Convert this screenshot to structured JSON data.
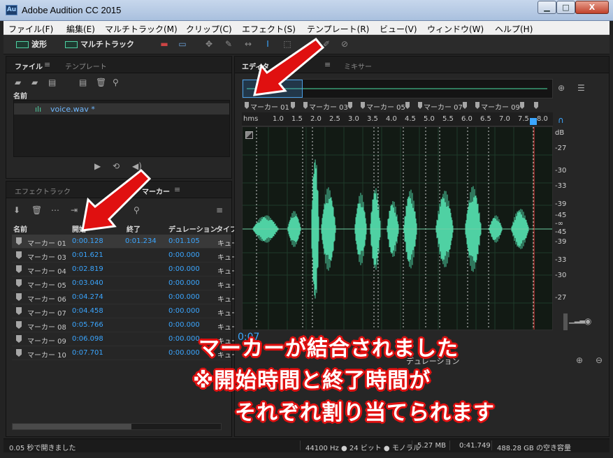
{
  "window": {
    "title": "Adobe Audition CC 2015",
    "app_icon": "Au",
    "min": "▁",
    "max": "□",
    "close": "X"
  },
  "menu": [
    "ファイル(F)",
    "編集(E)",
    "マルチトラック(M)",
    "クリップ(C)",
    "エフェクト(S)",
    "テンプレート(R)",
    "ビュー(V)",
    "ウィンドウ(W)",
    "ヘルプ(H)"
  ],
  "toolbar": {
    "waveform": "波形",
    "multitrack": "マルチトラック"
  },
  "files_panel": {
    "tab_active": "ファイル",
    "tab_other": "テンプレート",
    "col_name": "名前",
    "file": "voice.wav *"
  },
  "bottom_panel": {
    "tab_effects": "エフェクトラック",
    "tab_markers": "マーカー"
  },
  "markers_table": {
    "headers": {
      "name": "名前",
      "start": "開始",
      "end": "終了",
      "duration": "デュレーション",
      "type": "タイプ"
    },
    "rows": [
      {
        "name": "マーカー 01",
        "start": "0:00.128",
        "end": "0:01.234",
        "duration": "0:01.105",
        "type": "キュー"
      },
      {
        "name": "マーカー 03",
        "start": "0:01.621",
        "end": "",
        "duration": "0:00.000",
        "type": "キュー"
      },
      {
        "name": "マーカー 04",
        "start": "0:02.819",
        "end": "",
        "duration": "0:00.000",
        "type": "キュー"
      },
      {
        "name": "マーカー 05",
        "start": "0:03.040",
        "end": "",
        "duration": "0:00.000",
        "type": "キュー"
      },
      {
        "name": "マーカー 06",
        "start": "0:04.274",
        "end": "",
        "duration": "0:00.000",
        "type": "キュー"
      },
      {
        "name": "マーカー 07",
        "start": "0:04.458",
        "end": "",
        "duration": "0:00.000",
        "type": "キュー"
      },
      {
        "name": "マーカー 08",
        "start": "0:05.766",
        "end": "",
        "duration": "0:00.000",
        "type": "キュー"
      },
      {
        "name": "マーカー 09",
        "start": "0:06.098",
        "end": "",
        "duration": "0:00.000",
        "type": "キュー"
      },
      {
        "name": "マーカー 10",
        "start": "0:07.701",
        "end": "",
        "duration": "0:00.000",
        "type": "キュー"
      }
    ]
  },
  "editor": {
    "tab_editor": "エディタ",
    "tab_mixer": "ミキサー",
    "marker_lane": [
      "マーカー 01",
      "マーカー 03",
      "マーカー 05",
      "マーカー 07",
      "マーカー 09"
    ],
    "ruler": {
      "unit": "hms",
      "ticks": [
        "1.0",
        "1.5",
        "2.0",
        "2.5",
        "3.0",
        "3.5",
        "4.0",
        "4.5",
        "5.0",
        "5.5",
        "6.0",
        "6.5",
        "7.0",
        "7.5",
        "8.0"
      ]
    },
    "db_scale": [
      "dB",
      "-27",
      "-30",
      "-33",
      "-39",
      "-45",
      "-∞",
      "-45",
      "-39",
      "-33",
      "-30",
      "-27"
    ],
    "time_display": "0:07",
    "selection_label": "デュレーション"
  },
  "status": {
    "message": "0.05 秒で開きました",
    "format": "44100 Hz ● 24 ビット ● モノラル",
    "size": "5.27 MB",
    "duration": "0:41.749",
    "free": "488.28 GB の空き容量"
  },
  "annotation": {
    "line1": "マーカーが結合されました",
    "line2": "※開始時間と終了時間が",
    "line3": "それぞれ割り当てられます"
  },
  "colors": {
    "accent_blue": "#3ba6ff",
    "waveform_green": "#4fd1a3",
    "arrow_red": "#e01010"
  }
}
